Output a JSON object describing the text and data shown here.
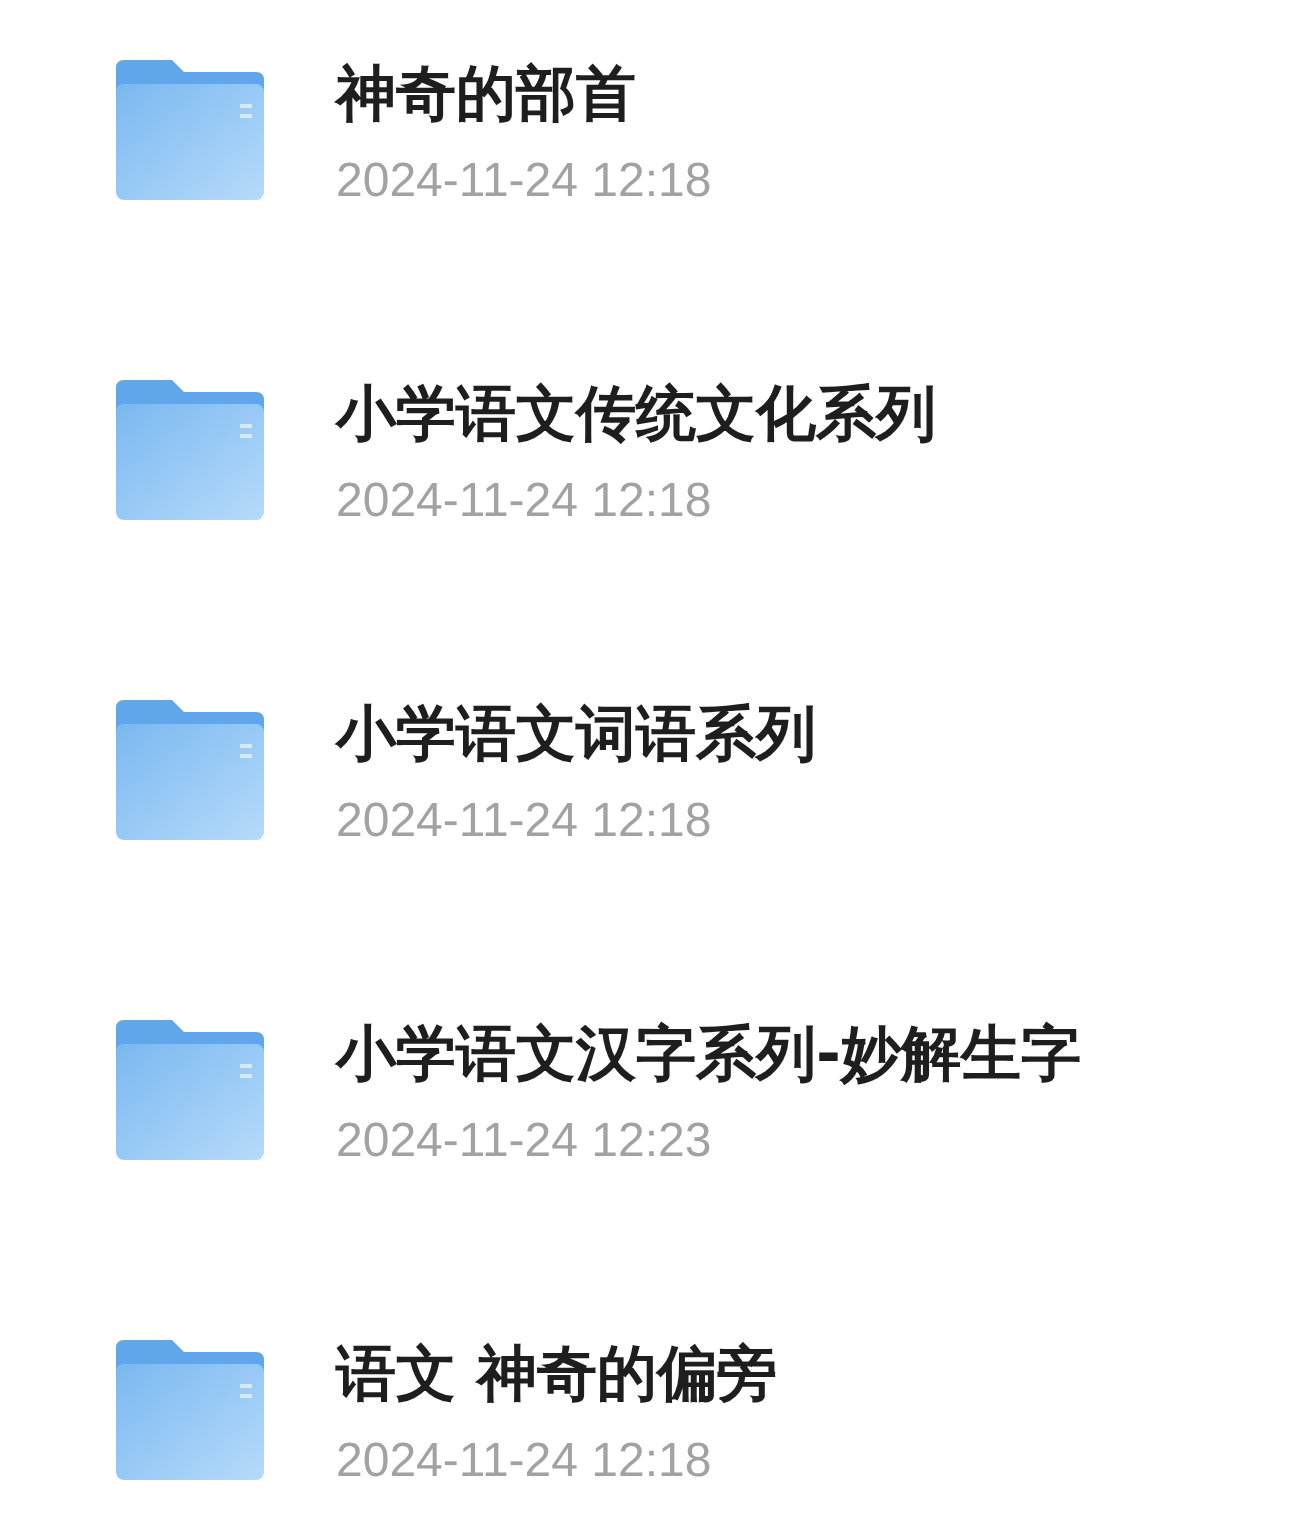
{
  "folders": [
    {
      "name": "神奇的部首",
      "modified": "2024-11-24 12:18"
    },
    {
      "name": "小学语文传统文化系列",
      "modified": "2024-11-24 12:18"
    },
    {
      "name": "小学语文词语系列",
      "modified": "2024-11-24 12:18"
    },
    {
      "name": "小学语文汉字系列-妙解生字",
      "modified": "2024-11-24 12:23"
    },
    {
      "name": "语文 神奇的偏旁",
      "modified": "2024-11-24 12:18"
    }
  ]
}
